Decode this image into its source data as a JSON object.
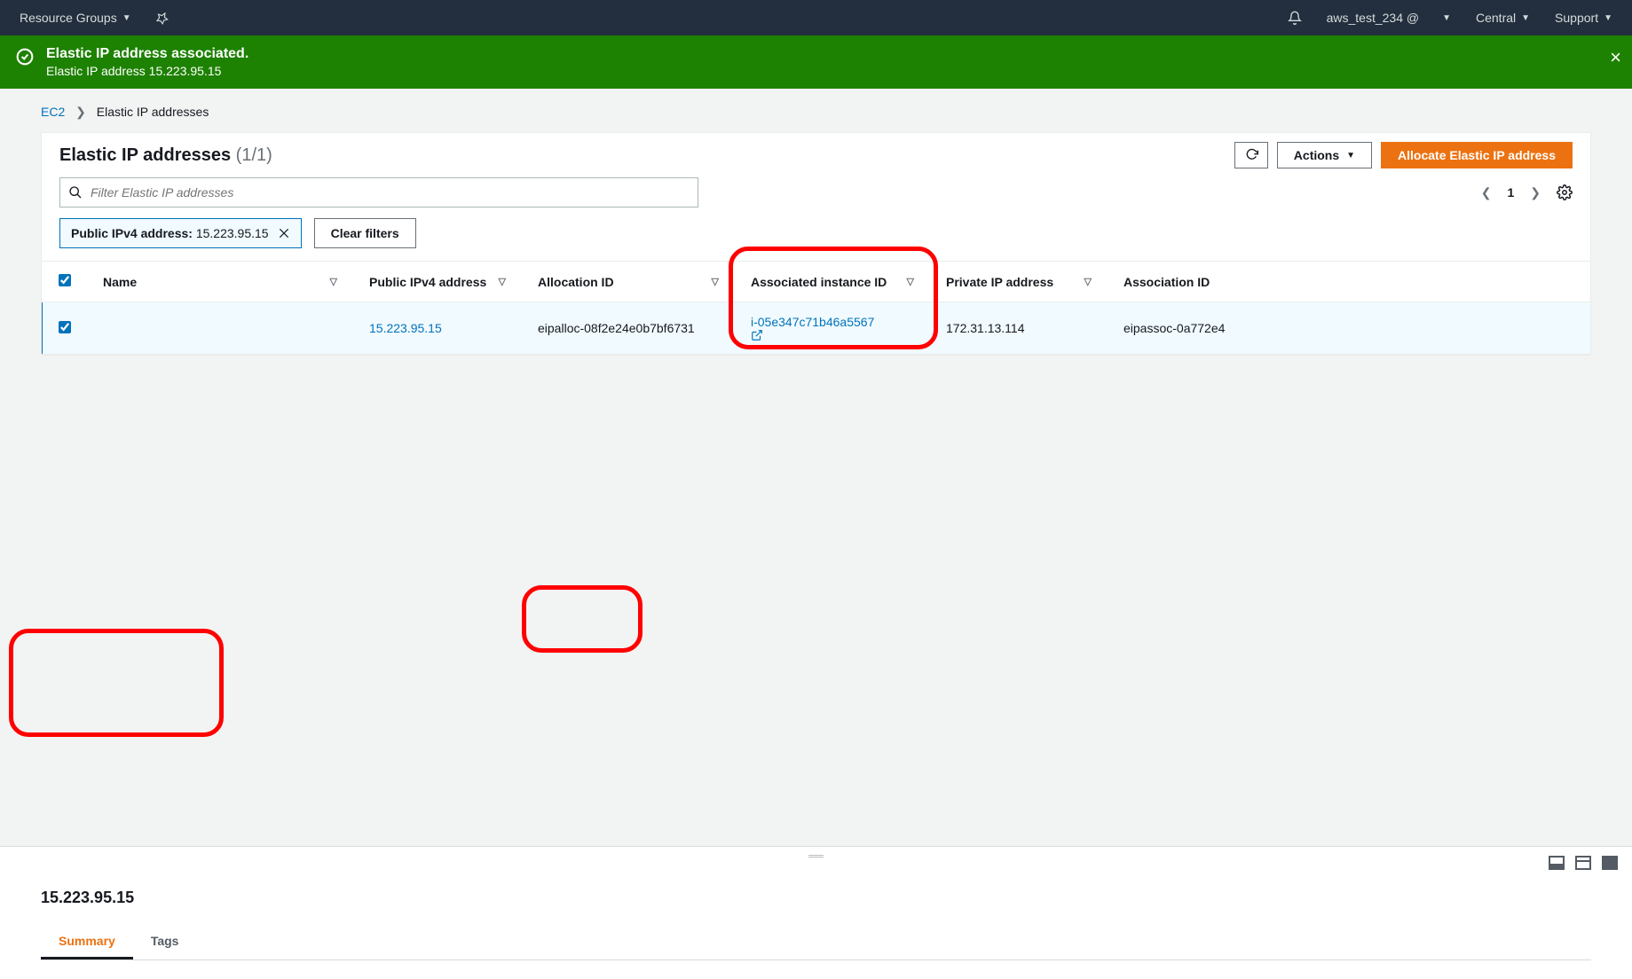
{
  "topnav": {
    "resource_groups": "Resource Groups",
    "account": "aws_test_234 @",
    "region": "Central",
    "support": "Support"
  },
  "flash": {
    "title": "Elastic IP address associated.",
    "subtitle": "Elastic IP address 15.223.95.15"
  },
  "breadcrumb": {
    "root": "EC2",
    "current": "Elastic IP addresses"
  },
  "header": {
    "title": "Elastic IP addresses",
    "count": "(1/1)",
    "actions": "Actions",
    "allocate": "Allocate Elastic IP address"
  },
  "filter": {
    "placeholder": "Filter Elastic IP addresses",
    "chip_key": "Public IPv4 address:",
    "chip_value": "15.223.95.15",
    "clear": "Clear filters",
    "page": "1"
  },
  "columns": {
    "name": "Name",
    "public_ip": "Public IPv4 address",
    "allocation_id": "Allocation ID",
    "associated_instance": "Associated instance ID",
    "private_ip": "Private IP address",
    "association_id": "Association ID"
  },
  "rows": [
    {
      "name": "",
      "public_ip": "15.223.95.15",
      "allocation_id": "eipalloc-08f2e24e0b7bf6731",
      "associated_instance": "i-05e347c71b46a5567",
      "private_ip": "172.31.13.114",
      "association_id": "eipassoc-0a772e4"
    }
  ],
  "detail": {
    "title": "15.223.95.15",
    "tabs": {
      "summary": "Summary",
      "tags": "Tags"
    }
  }
}
